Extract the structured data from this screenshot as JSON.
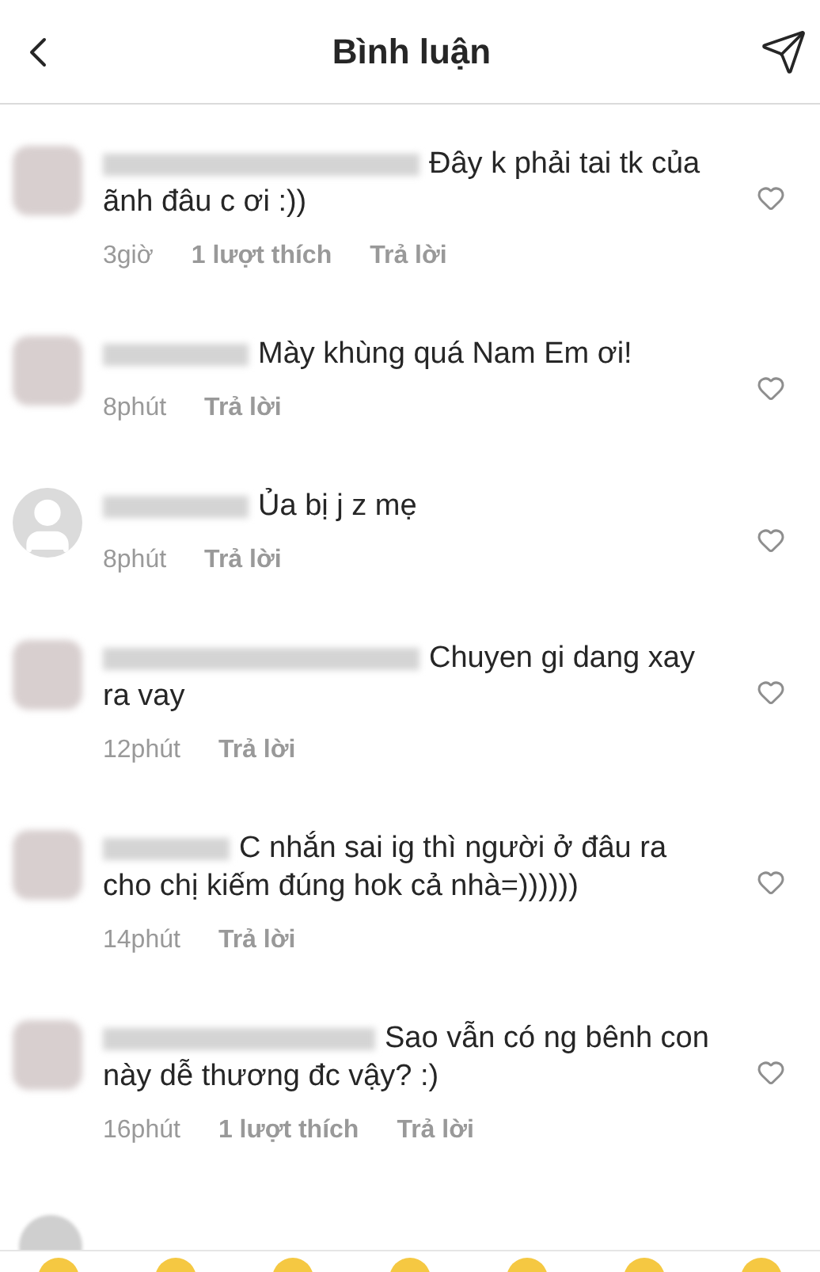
{
  "header": {
    "title": "Bình luận"
  },
  "comments": [
    {
      "avatar": {
        "kind": "blurred"
      },
      "text": "Đây k phải tai tk của ãnh đâu c ơi :))",
      "time": "3giờ",
      "likes": "1 lượt thích",
      "reply": "Trả lời"
    },
    {
      "avatar": {
        "kind": "blurred"
      },
      "text": "Mày khùng quá Nam Em ơi!",
      "time": "8phút",
      "reply": "Trả lời"
    },
    {
      "avatar": {
        "kind": "default"
      },
      "text": "Ủa bị j z mẹ",
      "time": "8phút",
      "reply": "Trả lời"
    },
    {
      "avatar": {
        "kind": "blurred"
      },
      "text": "Chuyen gi dang xay ra vay",
      "time": "12phút",
      "reply": "Trả lời"
    },
    {
      "avatar": {
        "kind": "blurred"
      },
      "text": "C nhắn sai ig thì người ở đâu ra cho chị kiếm đúng hok cả nhà=))))))",
      "time": "14phút",
      "reply": "Trả lời"
    },
    {
      "avatar": {
        "kind": "blurred"
      },
      "text": "Sao vẫn có ng bênh con này dễ thương đc vậy? :)",
      "time": "16phút",
      "likes": "1 lượt thích",
      "reply": "Trả lời"
    }
  ]
}
